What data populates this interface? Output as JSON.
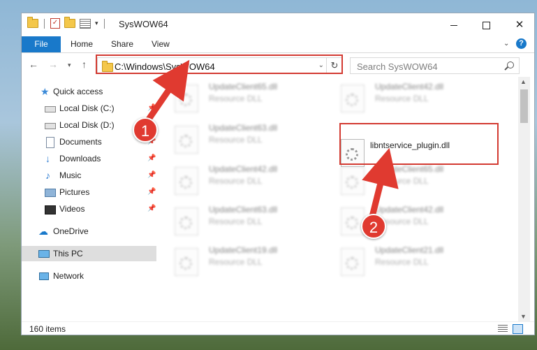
{
  "window": {
    "title": "SysWOW64",
    "controls": {
      "minimize": "minimize",
      "maximize": "maximize",
      "close": "✕"
    }
  },
  "ribbon": {
    "tabs": [
      "File",
      "Home",
      "Share",
      "View"
    ]
  },
  "address": {
    "path": "C:\\Windows\\SysWOW64",
    "search_placeholder": "Search SysWOW64"
  },
  "sidebar": {
    "items": [
      {
        "label": "Quick access",
        "icon": "star-icon",
        "pinned": false
      },
      {
        "label": "Local Disk (C:)",
        "icon": "disk-icon",
        "pinned": true
      },
      {
        "label": "Local Disk (D:)",
        "icon": "disk-icon",
        "pinned": false
      },
      {
        "label": "Documents",
        "icon": "documents-icon",
        "pinned": true
      },
      {
        "label": "Downloads",
        "icon": "downloads-icon",
        "pinned": true
      },
      {
        "label": "Music",
        "icon": "music-icon",
        "pinned": true
      },
      {
        "label": "Pictures",
        "icon": "pictures-icon",
        "pinned": true
      },
      {
        "label": "Videos",
        "icon": "videos-icon",
        "pinned": true
      },
      {
        "label": "OneDrive",
        "icon": "onedrive-icon",
        "pinned": false
      },
      {
        "label": "This PC",
        "icon": "this-pc-icon",
        "pinned": false,
        "selected": true
      },
      {
        "label": "Network",
        "icon": "network-icon",
        "pinned": false
      }
    ]
  },
  "files": [
    {
      "name": "UpdateClient65.dll",
      "type": "Resource DLL"
    },
    {
      "name": "UpdateClient42.dll",
      "type": "Resource DLL"
    },
    {
      "name": "UpdateClient63.dll",
      "type": "Resource DLL"
    },
    {
      "name": "libntservice_plugin.dll",
      "type": ""
    },
    {
      "name": "UpdateClient42.dll",
      "type": "Resource DLL"
    },
    {
      "name": "UpdateClient65.dll",
      "type": "Resource DLL"
    },
    {
      "name": "UpdateClient63.dll",
      "type": "Resource DLL"
    },
    {
      "name": "UpdateClient42.dll",
      "type": "Resource DLL"
    },
    {
      "name": "UpdateClient19.dll",
      "type": "Resource DLL"
    },
    {
      "name": "UpdateClient21.dll",
      "type": "Resource DLL"
    }
  ],
  "status": {
    "item_count": "160 items"
  },
  "annotations": {
    "step1": "1",
    "step2": "2",
    "accent": "#d33a31"
  }
}
